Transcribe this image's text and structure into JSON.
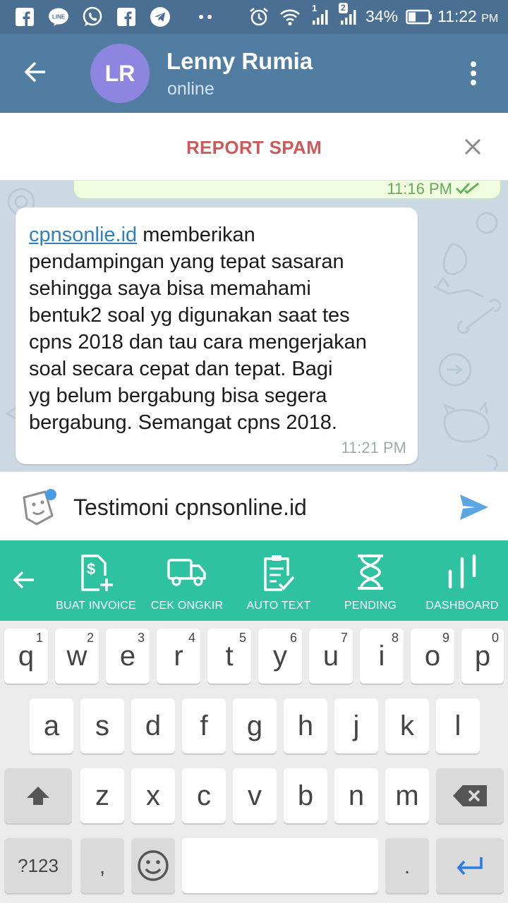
{
  "status_bar": {
    "battery_percent": "34%",
    "time": "11:22",
    "time_suffix": "PM",
    "sim1": "1",
    "sim2": "2",
    "notification_icons": [
      "facebook-icon",
      "line-icon",
      "whatsapp-icon",
      "facebook-icon",
      "telegram-icon"
    ]
  },
  "header": {
    "avatar_initials": "LR",
    "avatar_color": "#8e85e0",
    "contact_name": "Lenny Rumia",
    "contact_status": "online"
  },
  "spam_bar": {
    "report_label": "REPORT SPAM"
  },
  "chat": {
    "outgoing": {
      "time": "11:16 PM",
      "read": true
    },
    "incoming": {
      "link_text": "cpnsonlie.id",
      "text": " memberikan\npendampingan yang tepat sasaran\nsehingga saya  bisa memahami\nbentuk2 soal yg digunakan saat tes\ncpns 2018 dan tau cara mengerjakan\nsoal secara cepat dan tepat. Bagi\nyg belum bergabung bisa segera\nbergabung. Semangat cpns 2018.",
      "time": "11:21 PM"
    }
  },
  "composer": {
    "value": "Testimoni cpnsonline.id"
  },
  "toolbar": {
    "items": [
      {
        "label": "BUAT INVOICE",
        "icon": "invoice-icon"
      },
      {
        "label": "CEK ONGKIR",
        "icon": "truck-icon"
      },
      {
        "label": "AUTO TEXT",
        "icon": "clipboard-check-icon"
      },
      {
        "label": "PENDING",
        "icon": "hourglass-icon"
      },
      {
        "label": "DASHBOARD",
        "icon": "bar-chart-icon"
      }
    ]
  },
  "keyboard": {
    "row1": [
      {
        "key": "q",
        "hint": "1"
      },
      {
        "key": "w",
        "hint": "2"
      },
      {
        "key": "e",
        "hint": "3"
      },
      {
        "key": "r",
        "hint": "4"
      },
      {
        "key": "t",
        "hint": "5"
      },
      {
        "key": "y",
        "hint": "6"
      },
      {
        "key": "u",
        "hint": "7"
      },
      {
        "key": "i",
        "hint": "8"
      },
      {
        "key": "o",
        "hint": "9"
      },
      {
        "key": "p",
        "hint": "0"
      }
    ],
    "row2": [
      "a",
      "s",
      "d",
      "f",
      "g",
      "h",
      "j",
      "k",
      "l"
    ],
    "row3": [
      "z",
      "x",
      "c",
      "v",
      "b",
      "n",
      "m"
    ],
    "symbols_label": "?123",
    "comma": ",",
    "period": "."
  }
}
